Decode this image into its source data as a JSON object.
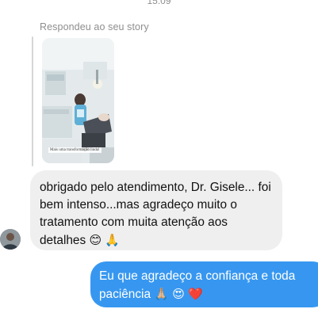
{
  "status": {
    "time": "15:09"
  },
  "thread": {
    "reply_label": "Respondeu ao seu story",
    "story": {
      "caption": "Mais uma transformação linda!",
      "description_icon": "dental-clinic-photo"
    },
    "incoming_message": {
      "text": "obrigado pelo atendimento, Dr. Gisele... foi bem intenso...mas agradeço muito o tratamento com muita atenção aos detalhes",
      "emojis": [
        "😊",
        "🙏"
      ]
    },
    "outgoing_message": {
      "text": "Eu que agradeço a confiança e toda paciência",
      "emojis": [
        "🙏🏼",
        "😍",
        "❤️"
      ]
    }
  },
  "colors": {
    "outgoing_bubble": "#3797f0",
    "incoming_bubble": "#efefef",
    "muted_text": "#8e8e8e"
  }
}
